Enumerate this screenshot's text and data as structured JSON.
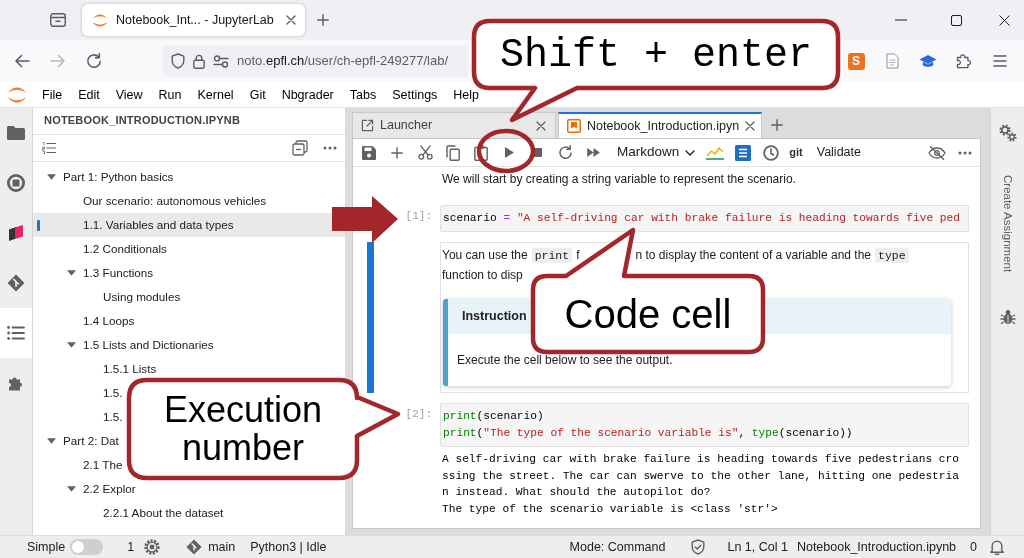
{
  "browser": {
    "tab_title": "Notebook_Int... - JupyterLab",
    "nav_buttons": [
      {
        "disabled": false
      },
      {
        "disabled": true
      },
      {
        "disabled": false
      }
    ],
    "url": "noto.**epfl.ch**/user/ch-epfl-249277/lab/",
    "extension_badge": "S"
  },
  "menu": [
    "File",
    "Edit",
    "View",
    "Run",
    "Kernel",
    "Git",
    "Nbgrader",
    "Tabs",
    "Settings",
    "Help"
  ],
  "activity_bar": [
    {
      "selected": false
    },
    {
      "selected": false
    },
    {
      "selected": false
    },
    {
      "selected": false
    },
    {
      "selected": true
    },
    {
      "selected": false
    }
  ],
  "left_panel": {
    "title": "NOTEBOOK_INTRODUCTION.IPYNB",
    "toc": [
      {
        "label": "Part 1: Python basics",
        "expanded": true,
        "selected": false,
        "children": [
          {
            "label": "Our scenario: autonomous vehicles",
            "selected": false
          },
          {
            "label": "1.1. Variables and data types",
            "selected": true
          },
          {
            "label": "1.2 Conditionals",
            "selected": false
          },
          {
            "label": "1.3 Functions",
            "expanded": true,
            "selected": false,
            "children": [
              {
                "label": "Using modules",
                "selected": false
              }
            ]
          },
          {
            "label": "1.4 Loops",
            "selected": false
          },
          {
            "label": "1.5 Lists and Dictionaries",
            "expanded": true,
            "selected": false,
            "children": [
              {
                "label": "1.5.1 Lists",
                "selected": false
              },
              {
                "label": "1.5.",
                "selected": false
              },
              {
                "label": "1.5.",
                "selected": false
              }
            ]
          }
        ]
      },
      {
        "label": "Part 2: Dat",
        "expanded": true,
        "selected": false,
        "children": [
          {
            "label": "2.1 The",
            "selected": false
          },
          {
            "label": "2.2 Explor",
            "expanded": true,
            "selected": false,
            "children": [
              {
                "label": "2.2.1 About the dataset",
                "selected": false
              }
            ]
          }
        ]
      }
    ]
  },
  "notebook": {
    "tabs": [
      {
        "label": "Launcher",
        "selected": false
      },
      {
        "label": "Notebook_Introduction.ipyn",
        "selected": true
      }
    ],
    "toolbar": {
      "cell_type": "Markdown",
      "git": "git",
      "validate": "Validate"
    },
    "cells": [
      {
        "kind": "markdown",
        "selected": false,
        "lines": [
          {
            "fragments": [
              [
                {
                  "kind": "text",
                  "text": "We will start by creating a string variable to represent the scenario."
                }
              ]
            ]
          }
        ]
      },
      {
        "kind": "code",
        "selected": false,
        "prompt": "[1]:",
        "source": [
          [
            {
              "kind": "name",
              "text": "scenario"
            },
            {
              "kind": "operator",
              "text": " = "
            },
            {
              "kind": "string",
              "text": "\"A self-driving car with brake failure is heading towards five ped"
            }
          ]
        ]
      },
      {
        "kind": "markdown",
        "selected": true,
        "lines": [
          {
            "fragments": [
              [
                {
                  "kind": "text",
                  "text": "You can use the"
                },
                {
                  "kind": "code",
                  "text": "print"
                },
                {
                  "kind": "text",
                  "text": "f"
                }
              ],
              [
                {
                  "kind": "text",
                  "text": "n to display the content of a variable and the"
                },
                {
                  "kind": "code",
                  "text": "type"
                }
              ]
            ]
          },
          {
            "fragments": [
              [
                {
                  "kind": "text",
                  "text": "function to disp"
                }
              ]
            ]
          }
        ],
        "alert": {
          "title": "Instruction",
          "body": "Execute the cell below to see the output."
        }
      },
      {
        "kind": "code",
        "selected": false,
        "prompt": "[2]:",
        "source": [
          [
            {
              "kind": "builtin",
              "text": "print"
            },
            {
              "kind": "name",
              "text": "(scenario)"
            }
          ],
          [
            {
              "kind": "builtin",
              "text": "print"
            },
            {
              "kind": "name",
              "text": "("
            },
            {
              "kind": "string",
              "text": "\"The type of the scenario variable is\""
            },
            {
              "kind": "name",
              "text": ", "
            },
            {
              "kind": "builtin",
              "text": "type"
            },
            {
              "kind": "name",
              "text": "(scenario))"
            }
          ]
        ],
        "output": [
          "A self-driving car with brake failure is heading towards five pedestrians cro",
          "ssing the street. The car can swerve to the other lane, hitting one pedestria",
          "n instead. What should the autopilot do?",
          "The type of the scenario variable is <class 'str'>"
        ]
      }
    ]
  },
  "right_sidebar": {
    "label": "Create Assignment"
  },
  "status_bar": {
    "mode_label": "Simple",
    "simple_mode": false,
    "terminals": "1",
    "branch": "main",
    "kernel": "Python3 | Idle",
    "mode": "Mode: Command",
    "position": "Ln 1, Col 1",
    "file": "Notebook_Introduction.ipynb",
    "notifications": "0"
  },
  "annotations": [
    {
      "kind": "callout",
      "lines": [
        "Shift + enter"
      ]
    },
    {
      "kind": "callout",
      "lines": [
        "Code cell"
      ]
    },
    {
      "kind": "callout",
      "lines": [
        "Execution",
        "number"
      ]
    },
    {
      "kind": "arrow"
    },
    {
      "kind": "ring"
    }
  ]
}
